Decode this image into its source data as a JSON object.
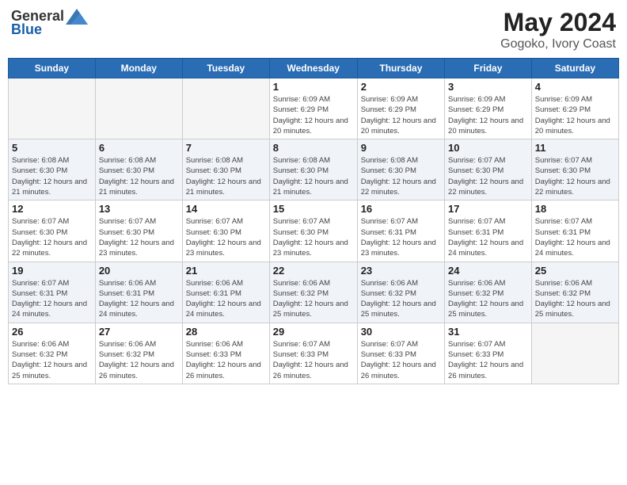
{
  "header": {
    "logo_general": "General",
    "logo_blue": "Blue",
    "month_year": "May 2024",
    "location": "Gogoko, Ivory Coast"
  },
  "weekdays": [
    "Sunday",
    "Monday",
    "Tuesday",
    "Wednesday",
    "Thursday",
    "Friday",
    "Saturday"
  ],
  "weeks": [
    [
      {
        "day": "",
        "info": ""
      },
      {
        "day": "",
        "info": ""
      },
      {
        "day": "",
        "info": ""
      },
      {
        "day": "1",
        "info": "Sunrise: 6:09 AM\nSunset: 6:29 PM\nDaylight: 12 hours and 20 minutes."
      },
      {
        "day": "2",
        "info": "Sunrise: 6:09 AM\nSunset: 6:29 PM\nDaylight: 12 hours and 20 minutes."
      },
      {
        "day": "3",
        "info": "Sunrise: 6:09 AM\nSunset: 6:29 PM\nDaylight: 12 hours and 20 minutes."
      },
      {
        "day": "4",
        "info": "Sunrise: 6:09 AM\nSunset: 6:29 PM\nDaylight: 12 hours and 20 minutes."
      }
    ],
    [
      {
        "day": "5",
        "info": "Sunrise: 6:08 AM\nSunset: 6:30 PM\nDaylight: 12 hours and 21 minutes."
      },
      {
        "day": "6",
        "info": "Sunrise: 6:08 AM\nSunset: 6:30 PM\nDaylight: 12 hours and 21 minutes."
      },
      {
        "day": "7",
        "info": "Sunrise: 6:08 AM\nSunset: 6:30 PM\nDaylight: 12 hours and 21 minutes."
      },
      {
        "day": "8",
        "info": "Sunrise: 6:08 AM\nSunset: 6:30 PM\nDaylight: 12 hours and 21 minutes."
      },
      {
        "day": "9",
        "info": "Sunrise: 6:08 AM\nSunset: 6:30 PM\nDaylight: 12 hours and 22 minutes."
      },
      {
        "day": "10",
        "info": "Sunrise: 6:07 AM\nSunset: 6:30 PM\nDaylight: 12 hours and 22 minutes."
      },
      {
        "day": "11",
        "info": "Sunrise: 6:07 AM\nSunset: 6:30 PM\nDaylight: 12 hours and 22 minutes."
      }
    ],
    [
      {
        "day": "12",
        "info": "Sunrise: 6:07 AM\nSunset: 6:30 PM\nDaylight: 12 hours and 22 minutes."
      },
      {
        "day": "13",
        "info": "Sunrise: 6:07 AM\nSunset: 6:30 PM\nDaylight: 12 hours and 23 minutes."
      },
      {
        "day": "14",
        "info": "Sunrise: 6:07 AM\nSunset: 6:30 PM\nDaylight: 12 hours and 23 minutes."
      },
      {
        "day": "15",
        "info": "Sunrise: 6:07 AM\nSunset: 6:30 PM\nDaylight: 12 hours and 23 minutes."
      },
      {
        "day": "16",
        "info": "Sunrise: 6:07 AM\nSunset: 6:31 PM\nDaylight: 12 hours and 23 minutes."
      },
      {
        "day": "17",
        "info": "Sunrise: 6:07 AM\nSunset: 6:31 PM\nDaylight: 12 hours and 24 minutes."
      },
      {
        "day": "18",
        "info": "Sunrise: 6:07 AM\nSunset: 6:31 PM\nDaylight: 12 hours and 24 minutes."
      }
    ],
    [
      {
        "day": "19",
        "info": "Sunrise: 6:07 AM\nSunset: 6:31 PM\nDaylight: 12 hours and 24 minutes."
      },
      {
        "day": "20",
        "info": "Sunrise: 6:06 AM\nSunset: 6:31 PM\nDaylight: 12 hours and 24 minutes."
      },
      {
        "day": "21",
        "info": "Sunrise: 6:06 AM\nSunset: 6:31 PM\nDaylight: 12 hours and 24 minutes."
      },
      {
        "day": "22",
        "info": "Sunrise: 6:06 AM\nSunset: 6:32 PM\nDaylight: 12 hours and 25 minutes."
      },
      {
        "day": "23",
        "info": "Sunrise: 6:06 AM\nSunset: 6:32 PM\nDaylight: 12 hours and 25 minutes."
      },
      {
        "day": "24",
        "info": "Sunrise: 6:06 AM\nSunset: 6:32 PM\nDaylight: 12 hours and 25 minutes."
      },
      {
        "day": "25",
        "info": "Sunrise: 6:06 AM\nSunset: 6:32 PM\nDaylight: 12 hours and 25 minutes."
      }
    ],
    [
      {
        "day": "26",
        "info": "Sunrise: 6:06 AM\nSunset: 6:32 PM\nDaylight: 12 hours and 25 minutes."
      },
      {
        "day": "27",
        "info": "Sunrise: 6:06 AM\nSunset: 6:32 PM\nDaylight: 12 hours and 26 minutes."
      },
      {
        "day": "28",
        "info": "Sunrise: 6:06 AM\nSunset: 6:33 PM\nDaylight: 12 hours and 26 minutes."
      },
      {
        "day": "29",
        "info": "Sunrise: 6:07 AM\nSunset: 6:33 PM\nDaylight: 12 hours and 26 minutes."
      },
      {
        "day": "30",
        "info": "Sunrise: 6:07 AM\nSunset: 6:33 PM\nDaylight: 12 hours and 26 minutes."
      },
      {
        "day": "31",
        "info": "Sunrise: 6:07 AM\nSunset: 6:33 PM\nDaylight: 12 hours and 26 minutes."
      },
      {
        "day": "",
        "info": ""
      }
    ]
  ]
}
